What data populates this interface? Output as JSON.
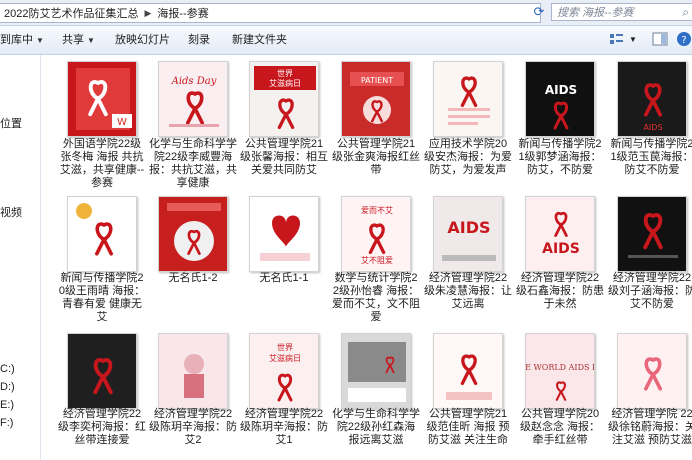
{
  "address": {
    "crumbs": [
      "2022防艾艺术作品征集汇总",
      "海报--参赛"
    ],
    "search_placeholder": "搜索 海报--参赛"
  },
  "toolbar": {
    "library": "到库中",
    "share": "共享",
    "slideshow": "放映幻灯片",
    "burn": "刻录",
    "new_folder": "新建文件夹"
  },
  "sidebar": {
    "items": [
      "位置",
      "视频",
      "C:)",
      "D:)",
      "E:)",
      "F:)"
    ]
  },
  "files": [
    {
      "caption": "外国语学院22级张冬梅 海报 共抗艾滋，共享健康--参赛",
      "thumb": "red-ribbon-wps"
    },
    {
      "caption": "化学与生命科学学院22级李威豐海报：共抗艾滋，共享健康",
      "thumb": "aids-day-pink"
    },
    {
      "caption": "公共管理学院21级张馨海报：相互关爱共同防艾",
      "thumb": "world-aids-day-red"
    },
    {
      "caption": "公共管理学院21级张金爽海报红丝带",
      "thumb": "patient-red"
    },
    {
      "caption": "应用技术学院20级安杰海报：为爱防艾，为爱发声",
      "thumb": "white-ribbon"
    },
    {
      "caption": "新闻与传播学院21级郭梦涵海报：防艾，不防爱",
      "thumb": "black-aids"
    },
    {
      "caption": "新闻与传播学院21级范玉苠海报：防艾不防爱",
      "thumb": "black-ribbon-aids"
    },
    {
      "caption": "新闻与传播学院20级王雨晴 海报：青春有爱 健康无艾",
      "thumb": "white-sun"
    },
    {
      "caption": "无名氏1-2",
      "thumb": "red-circle"
    },
    {
      "caption": "无名氏1-1",
      "thumb": "heart-pink"
    },
    {
      "caption": "数学与统计学院22级孙怡睿 海报：爱而不艾，文不阻爱",
      "thumb": "pink-love"
    },
    {
      "caption": "经济管理学院22级朱凌慧海报：让艾远离",
      "thumb": "aids-gray"
    },
    {
      "caption": "经济管理学院22级石鑫海报：防患于未然",
      "thumb": "aids-pink-big"
    },
    {
      "caption": "经济管理学院22级刘子涵海报：防艾不防爱",
      "thumb": "black-ribbon-2"
    },
    {
      "caption": "经济管理学院22级李奕柯海报：红丝带连接爱",
      "thumb": "dark-ribbon"
    },
    {
      "caption": "经济管理学院22级陈玥辛海报：防艾2",
      "thumb": "pink-figure"
    },
    {
      "caption": "经济管理学院22级陈玥辛海报：防艾1",
      "thumb": "world-aids-day-pink"
    },
    {
      "caption": "化学与生命科学学院22级孙红森海报远离艾滋",
      "thumb": "bw-photo"
    },
    {
      "caption": "公共管理学院21级范佳昕 海报 预防艾滋 关注生命",
      "thumb": "pale-ribbon"
    },
    {
      "caption": "公共管理学院20级赵念念 海报：牵手红丝带",
      "thumb": "hands-pink"
    },
    {
      "caption": "经济管理学院 22级徐铭蔚海报：关注艾滋 预防艾滋",
      "thumb": "pink-ribbon-light"
    }
  ],
  "colors": {
    "accent_red": "#c8161d",
    "toolbar_bg": "#e3ebf6",
    "link_blue": "#2a64b8"
  }
}
